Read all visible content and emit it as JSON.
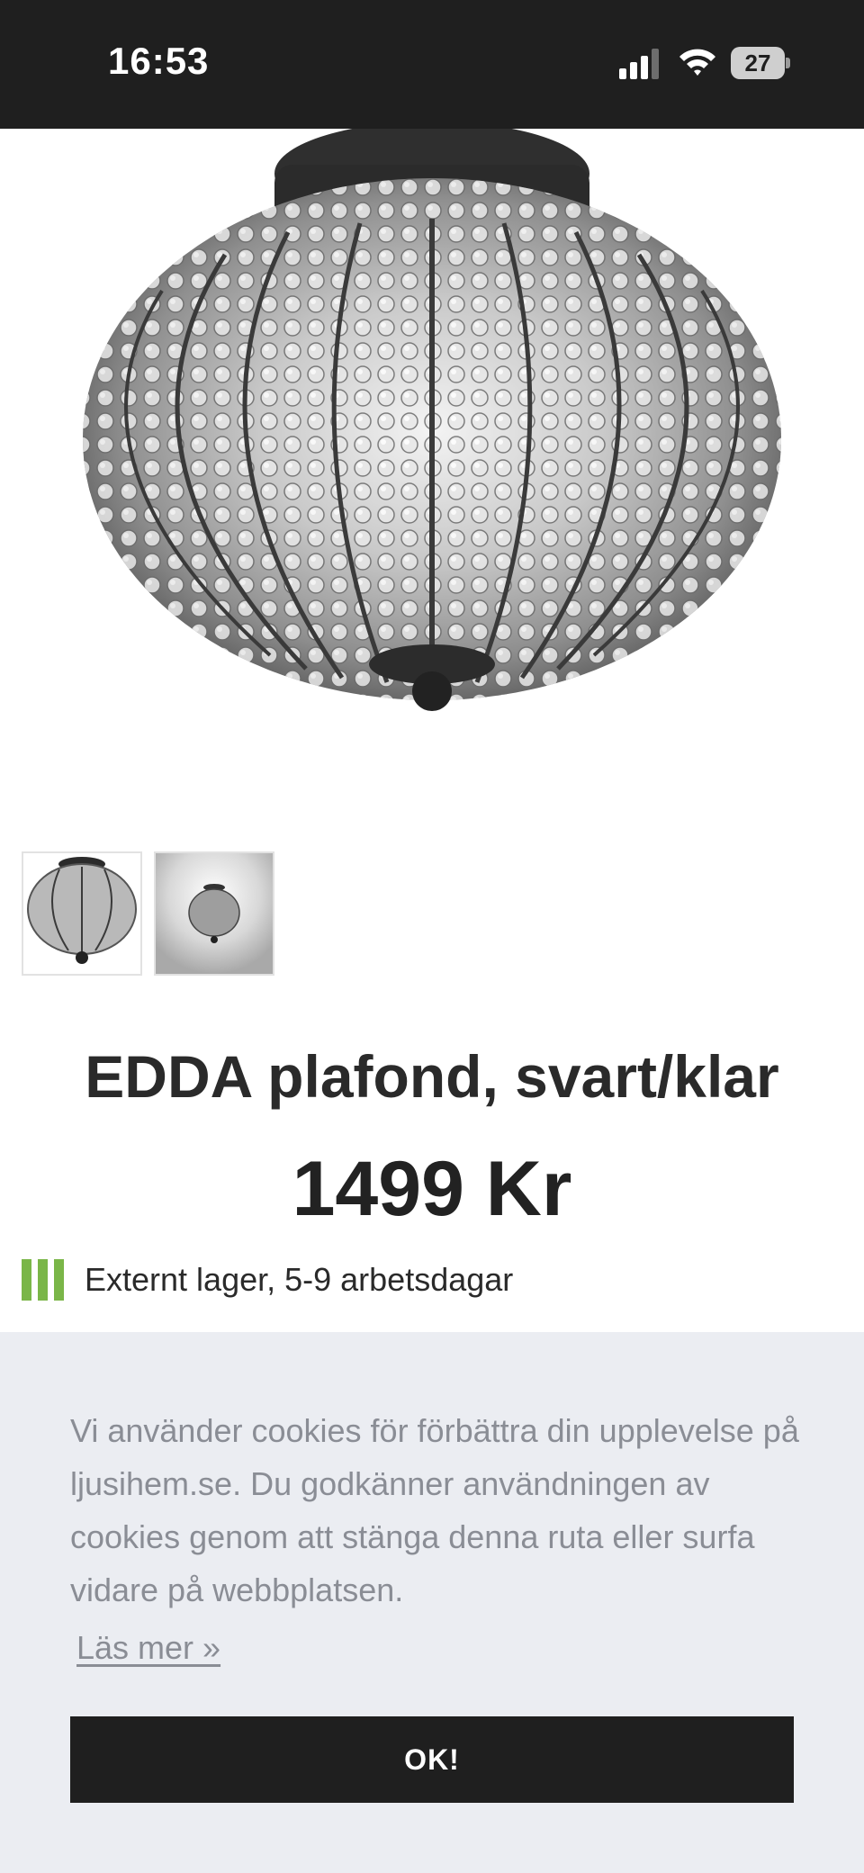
{
  "status_bar": {
    "time": "16:53",
    "battery_level": "27",
    "icons": [
      "signal-icon",
      "wifi-icon",
      "battery-icon"
    ]
  },
  "product": {
    "image": "lamp-product-image",
    "thumbnails": [
      "lamp-thumbnail",
      "lamp-lit-thumbnail"
    ],
    "title": "EDDA plafond, svart/klar",
    "price": "1499 Kr",
    "stock_text": "Externt lager, 5-9 arbetsdagar",
    "stock_color": "#7ab648"
  },
  "cookie_banner": {
    "text": "Vi använder cookies för förbättra din upplevelse på ljusihem.se. Du godkänner användningen av cookies genom att stänga denna ruta eller surfa vidare på webbplatsen.",
    "link_label": "Läs mer »",
    "ok_label": "OK!",
    "background": "#ebedf2",
    "button_color": "#1f1f1f"
  }
}
